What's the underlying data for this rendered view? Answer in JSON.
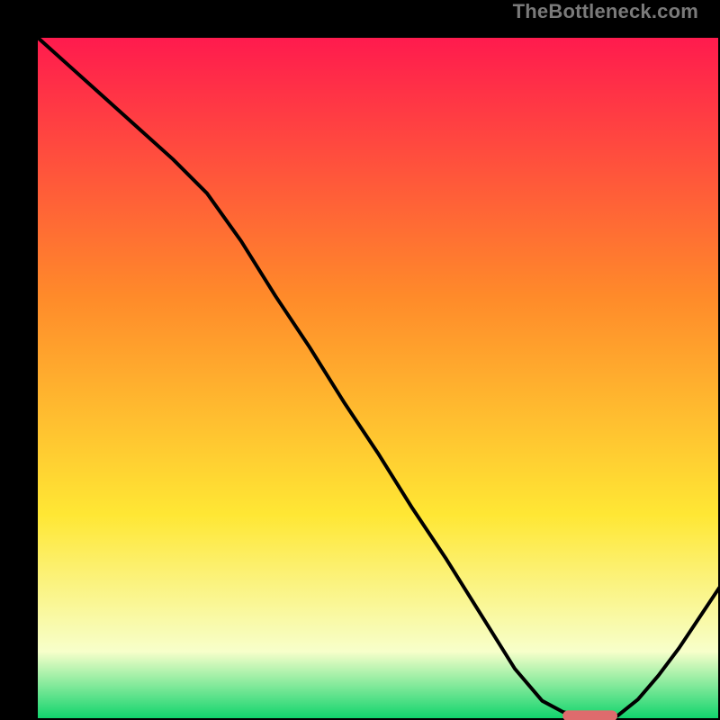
{
  "watermark": "TheBottleneck.com",
  "colors": {
    "gradient_top": "#ff1a4e",
    "gradient_mid1": "#ff8a2a",
    "gradient_mid2": "#ffe734",
    "gradient_pale": "#f7ffca",
    "gradient_bottom": "#0bd36a",
    "frame": "#000000",
    "curve": "#000000",
    "marker": "#de6b6d"
  },
  "chart_data": {
    "type": "line",
    "title": "",
    "xlabel": "",
    "ylabel": "",
    "xlim": [
      0,
      1
    ],
    "ylim": [
      0,
      1
    ],
    "x": [
      0.0,
      0.05,
      0.1,
      0.15,
      0.2,
      0.25,
      0.3,
      0.35,
      0.4,
      0.45,
      0.5,
      0.55,
      0.6,
      0.65,
      0.7,
      0.74,
      0.77,
      0.8,
      0.83,
      0.85,
      0.88,
      0.91,
      0.94,
      0.97,
      1.0
    ],
    "y": [
      1.0,
      0.955,
      0.91,
      0.865,
      0.82,
      0.77,
      0.7,
      0.62,
      0.545,
      0.465,
      0.39,
      0.31,
      0.235,
      0.155,
      0.075,
      0.028,
      0.012,
      0.004,
      0.004,
      0.006,
      0.03,
      0.065,
      0.105,
      0.15,
      0.195
    ],
    "optimum_marker": {
      "x_start": 0.77,
      "x_end": 0.85,
      "y": 0.006
    },
    "annotations": []
  }
}
